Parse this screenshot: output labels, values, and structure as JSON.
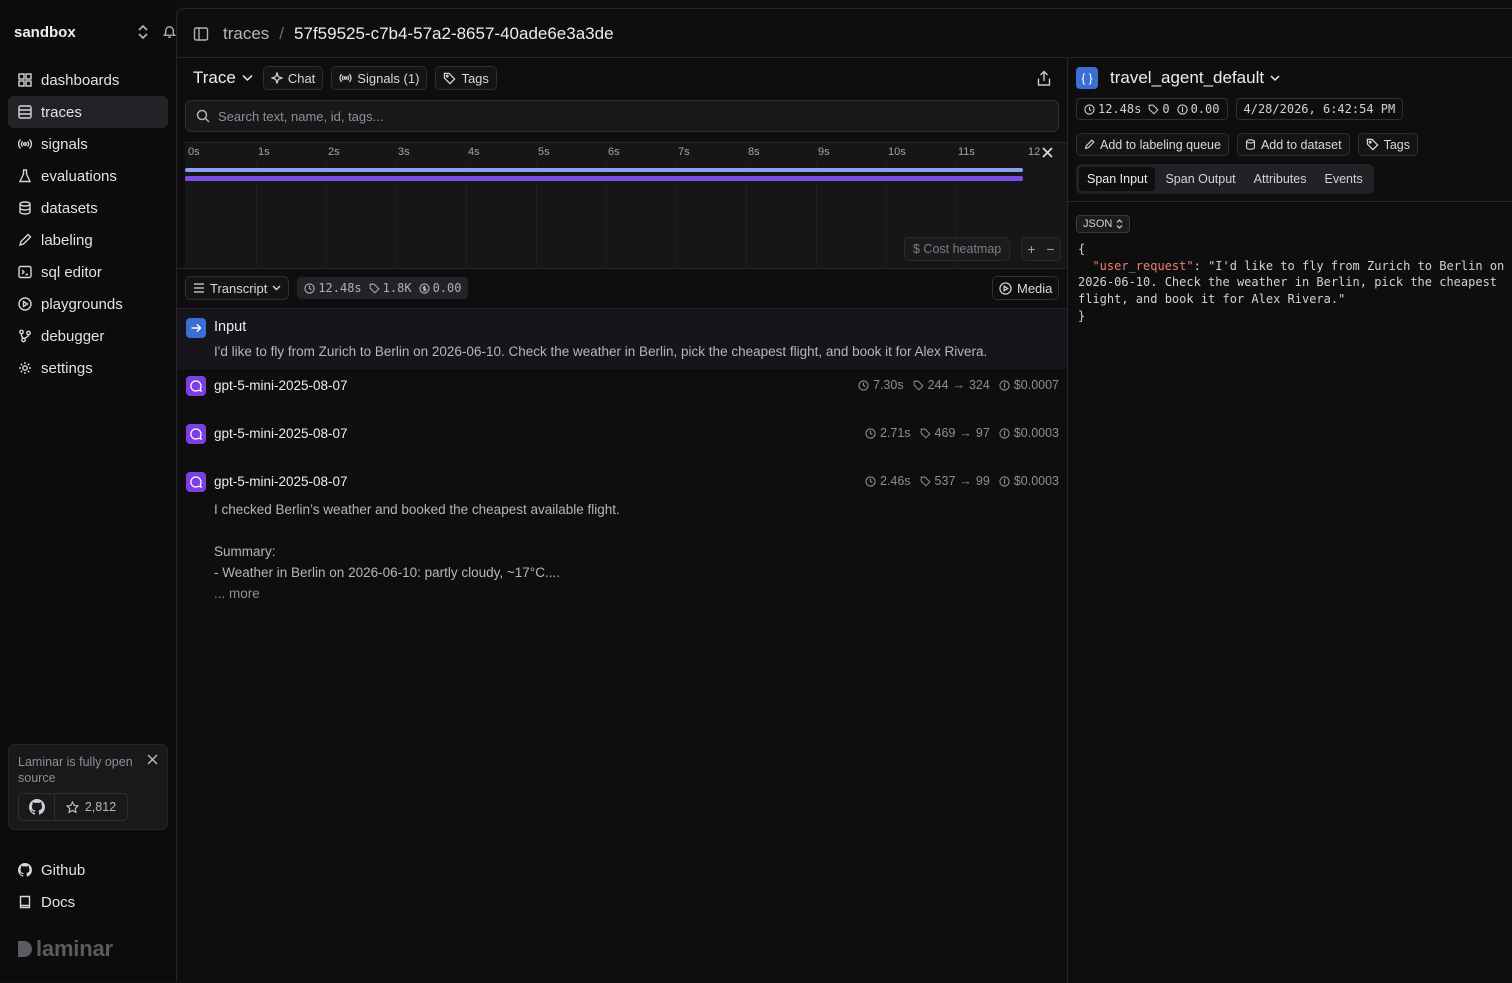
{
  "sidebar": {
    "workspace": "sandbox",
    "items": [
      {
        "label": "dashboards",
        "icon": "grid-icon"
      },
      {
        "label": "traces",
        "icon": "table-icon",
        "active": true
      },
      {
        "label": "signals",
        "icon": "broadcast-icon"
      },
      {
        "label": "evaluations",
        "icon": "flask-icon"
      },
      {
        "label": "datasets",
        "icon": "database-icon"
      },
      {
        "label": "labeling",
        "icon": "pen-icon"
      },
      {
        "label": "sql editor",
        "icon": "terminal-icon"
      },
      {
        "label": "playgrounds",
        "icon": "play-icon"
      },
      {
        "label": "debugger",
        "icon": "branch-icon"
      },
      {
        "label": "settings",
        "icon": "gear-icon"
      }
    ],
    "promo": {
      "text": "Laminar is fully open source",
      "stars": "2,812"
    },
    "footer": [
      {
        "label": "Github",
        "icon": "github-icon"
      },
      {
        "label": "Docs",
        "icon": "book-icon"
      }
    ],
    "brand": "laminar"
  },
  "header": {
    "breadcrumb_root": "traces",
    "breadcrumb_sep": "/",
    "trace_id": "57f59525-c7b4-57a2-8657-40ade6e3a3de"
  },
  "trace": {
    "title": "Trace",
    "chat_label": "Chat",
    "signals_label": "Signals (1)",
    "tags_label": "Tags",
    "search_placeholder": "Search text, name, id, tags...",
    "timeline": {
      "ticks": [
        "0s",
        "1s",
        "2s",
        "3s",
        "4s",
        "5s",
        "6s",
        "7s",
        "8s",
        "9s",
        "10s",
        "11s",
        "12"
      ],
      "cost_heatmap_label": "$ Cost heatmap"
    },
    "view_label": "Transcript",
    "stats": {
      "duration": "12.48s",
      "tokens": "1.8K",
      "cost": "0.00"
    },
    "media_label": "Media",
    "input": {
      "label": "Input",
      "text": "I'd like to fly from Zurich to Berlin on 2026-06-10. Check the weather in Berlin, pick the cheapest flight, and book it for Alex Rivera."
    },
    "spans": [
      {
        "name": "gpt-5-mini-2025-08-07",
        "duration": "7.30s",
        "tokens_in": "244",
        "tokens_out": "324",
        "cost": "$0.0007"
      },
      {
        "name": "gpt-5-mini-2025-08-07",
        "duration": "2.71s",
        "tokens_in": "469",
        "tokens_out": "97",
        "cost": "$0.0003"
      },
      {
        "name": "gpt-5-mini-2025-08-07",
        "duration": "2.46s",
        "tokens_in": "537",
        "tokens_out": "99",
        "cost": "$0.0003",
        "line1": "I checked Berlin’s weather and booked the cheapest available flight.",
        "line2": "Summary:",
        "line3": "- Weather in Berlin on 2026-06-10: partly cloudy, ~17°C....",
        "more": "... more"
      }
    ],
    "arrow": "→"
  },
  "detail": {
    "name": "travel_agent_default",
    "duration": "12.48s",
    "tokens": "0",
    "cost": "0.00",
    "timestamp": "4/28/2026, 6:42:54 PM",
    "actions": [
      "Add to labeling queue",
      "Add to dataset",
      "Tags"
    ],
    "tabs": [
      "Span Input",
      "Span Output",
      "Attributes",
      "Events"
    ],
    "format": "JSON",
    "json_key": "\"user_request\"",
    "json_value": "\"I'd like to fly from Zurich to Berlin on 2026-06-10. Check the weather in Berlin, pick the cheapest flight, and book it for Alex Rivera.\""
  }
}
